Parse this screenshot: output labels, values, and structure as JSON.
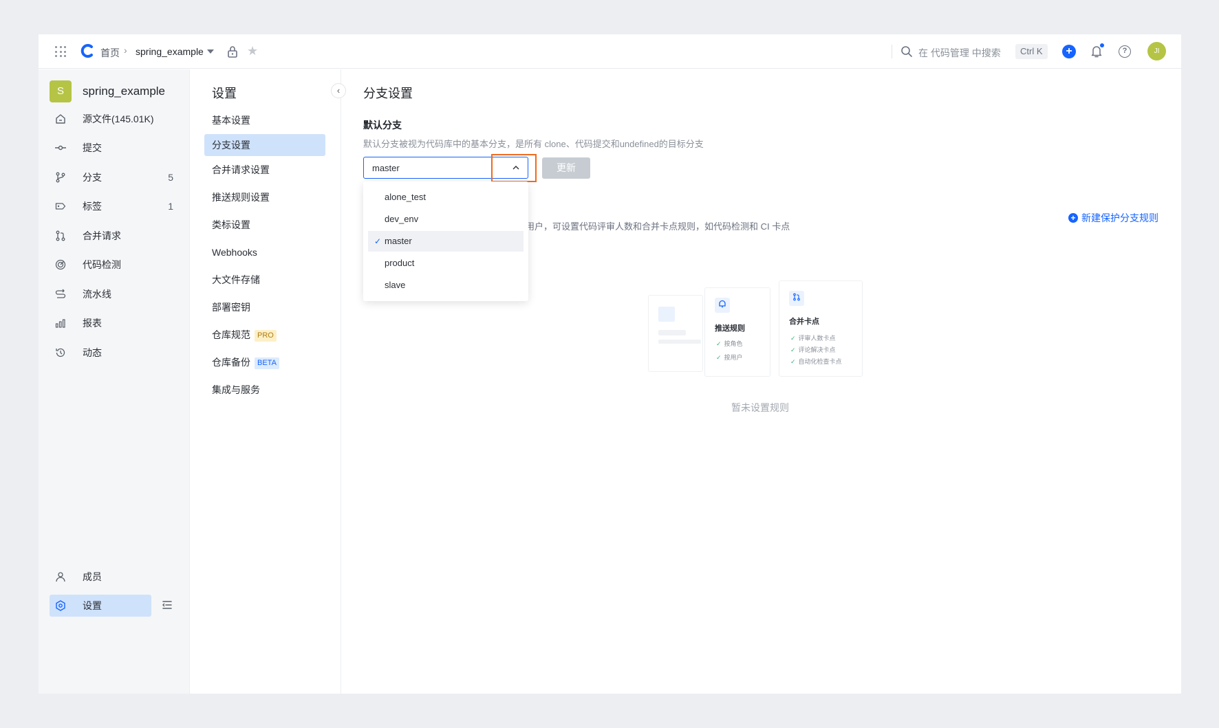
{
  "topbar": {
    "home": "首页",
    "repo": "spring_example",
    "search_text": "在 代码管理 中搜索",
    "shortcut": "Ctrl K",
    "avatar": "JI"
  },
  "sidebar": {
    "repo_initial": "S",
    "repo_name": "spring_example",
    "items": [
      {
        "label": "源文件(145.01K)",
        "icon": "home-doc-icon",
        "count": ""
      },
      {
        "label": "提交",
        "icon": "commit-icon",
        "count": ""
      },
      {
        "label": "分支",
        "icon": "branch-icon",
        "count": "5"
      },
      {
        "label": "标签",
        "icon": "tag-icon",
        "count": "1"
      },
      {
        "label": "合并请求",
        "icon": "merge-request-icon",
        "count": ""
      },
      {
        "label": "代码检测",
        "icon": "scan-icon",
        "count": ""
      },
      {
        "label": "流水线",
        "icon": "pipeline-icon",
        "count": ""
      },
      {
        "label": "报表",
        "icon": "chart-icon",
        "count": ""
      },
      {
        "label": "动态",
        "icon": "history-icon",
        "count": ""
      }
    ],
    "members": "成员",
    "settings": "设置"
  },
  "settings": {
    "title": "设置",
    "items": [
      {
        "label": "基本设置",
        "tag": ""
      },
      {
        "label": "分支设置",
        "tag": ""
      },
      {
        "label": "合并请求设置",
        "tag": ""
      },
      {
        "label": "推送规则设置",
        "tag": ""
      },
      {
        "label": "类标设置",
        "tag": ""
      },
      {
        "label": "Webhooks",
        "tag": ""
      },
      {
        "label": "大文件存储",
        "tag": ""
      },
      {
        "label": "部署密钥",
        "tag": ""
      },
      {
        "label": "仓库规范",
        "tag": "PRO"
      },
      {
        "label": "仓库备份",
        "tag": "BETA"
      },
      {
        "label": "集成与服务",
        "tag": ""
      }
    ]
  },
  "main": {
    "title": "分支设置",
    "default_branch": {
      "title": "默认分支",
      "desc": "默认分支被视为代码库中的基本分支，是所有 clone、代码提交和undefined的目标分支",
      "selected": "master",
      "update_label": "更新",
      "options": [
        "alone_test",
        "dev_env",
        "master",
        "product",
        "slave"
      ]
    },
    "protect": {
      "desc_partial": "用户，可设置代码评审人数和合并卡点规则，如代码检测和 CI 卡点",
      "new_rule": "新建保护分支规则",
      "card1_title": "推送规则",
      "card1_items": [
        "按角色",
        "按用户"
      ],
      "card2_title": "合并卡点",
      "card2_items": [
        "评审人数卡点",
        "评论解决卡点",
        "自动化检查卡点"
      ],
      "empty": "暂未设置规则"
    }
  },
  "colors": {
    "accent": "#1664ff",
    "highlight": "#f06a1d",
    "avatar": "#b5c445"
  }
}
